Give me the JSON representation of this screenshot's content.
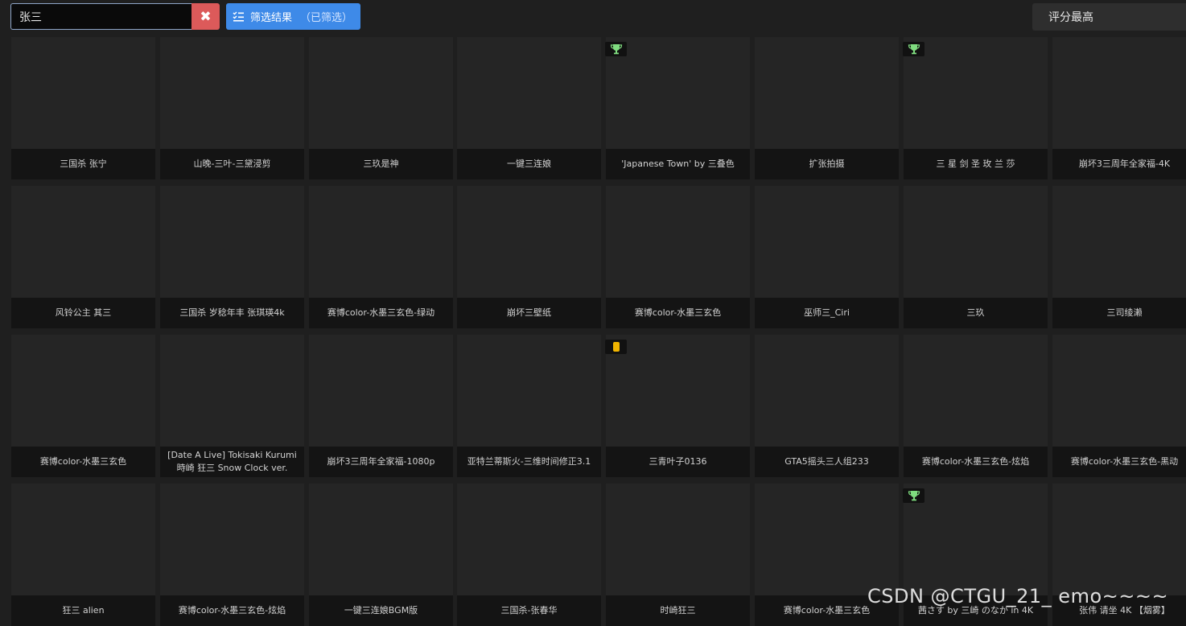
{
  "toolbar": {
    "search_value": "张三",
    "clear_icon": "close-icon",
    "filter_label": "筛选结果",
    "filter_tag": "（已筛选）",
    "sort_label": "评分最高"
  },
  "colors": {
    "background": "#1f1f1f",
    "card": "#252525",
    "label_bg": "#141414",
    "clear_button": "#dc5a5a",
    "filter_button": "#3e8ae8",
    "trophy": "#7fdc7f",
    "coin": "#f0b400"
  },
  "cards": [
    {
      "title": "三国杀 张宁",
      "badge": ""
    },
    {
      "title": "山晚-三叶-三黛浸剪",
      "badge": ""
    },
    {
      "title": "三玖是神",
      "badge": ""
    },
    {
      "title": "一键三连娘",
      "badge": ""
    },
    {
      "title": "'Japanese Town' by 三叠色",
      "badge": "trophy-icon"
    },
    {
      "title": "扩张拍摄",
      "badge": ""
    },
    {
      "title": "三 星 剑 圣 玫 兰 莎",
      "badge": "trophy-icon"
    },
    {
      "title": "崩坏3三周年全家福-4K",
      "badge": ""
    },
    {
      "title": "风铃公主 其三",
      "badge": ""
    },
    {
      "title": "三国杀 岁稔年丰 张琪瑛4k",
      "badge": ""
    },
    {
      "title": "赛博color-水墨三玄色-绿动",
      "badge": ""
    },
    {
      "title": "崩坏三壁纸",
      "badge": ""
    },
    {
      "title": "赛博color-水墨三玄色",
      "badge": ""
    },
    {
      "title": "巫师三_Ciri",
      "badge": ""
    },
    {
      "title": "三玖",
      "badge": ""
    },
    {
      "title": "三司绫濑",
      "badge": ""
    },
    {
      "title": "赛博color-水墨三玄色",
      "badge": ""
    },
    {
      "title": "[Date A Live] Tokisaki Kurumi 時崎 狂三 Snow Clock ver.",
      "badge": ""
    },
    {
      "title": "崩坏3三周年全家福-1080p",
      "badge": ""
    },
    {
      "title": "亚特兰蒂斯火-三维时间修正3.1",
      "badge": ""
    },
    {
      "title": "三青叶子0136",
      "badge": "coin-icon"
    },
    {
      "title": "GTA5摇头三人组233",
      "badge": ""
    },
    {
      "title": "赛博color-水墨三玄色-炫焰",
      "badge": ""
    },
    {
      "title": "赛博color-水墨三玄色-黑动",
      "badge": ""
    },
    {
      "title": "狂三 alien",
      "badge": ""
    },
    {
      "title": "赛博color-水墨三玄色-炫焰",
      "badge": ""
    },
    {
      "title": "一键三连娘BGM版",
      "badge": ""
    },
    {
      "title": "三国杀-张春华",
      "badge": ""
    },
    {
      "title": "时崎狂三",
      "badge": ""
    },
    {
      "title": "赛博color-水墨三玄色",
      "badge": ""
    },
    {
      "title": "茜さす by 三崎 のなか in 4K",
      "badge": "trophy-icon"
    },
    {
      "title": "张伟 请坐 4K 【烟雾】",
      "badge": ""
    }
  ],
  "watermark": "CSDN @CTGU_21_ emo~~~~"
}
